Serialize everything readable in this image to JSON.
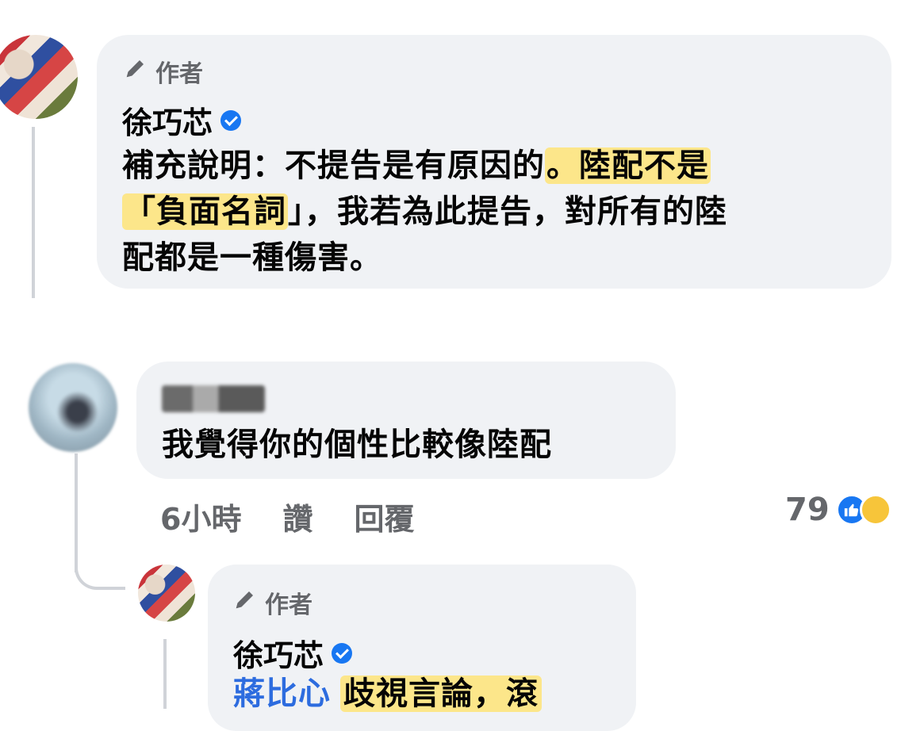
{
  "post_comment": {
    "badge": "作者",
    "author": "徐巧芯",
    "lines": [
      [
        {
          "t": "補充說明：不提告是有原因的",
          "h": false
        },
        {
          "t": "。陸配不是",
          "h": true
        }
      ],
      [
        {
          "t": "「負面名詞",
          "h": true
        },
        {
          "t": "」，我若為此提告，對所有的陸",
          "h": false
        }
      ],
      [
        {
          "t": "配都是一種傷害。",
          "h": false
        }
      ]
    ]
  },
  "reply_comment": {
    "text": "我覺得你的個性比較像陸配",
    "time": "6小時",
    "like_label": "讚",
    "reply_label": "回覆",
    "reaction_count": "79"
  },
  "nested_reply": {
    "badge": "作者",
    "author": "徐巧芯",
    "mention": "蔣比心",
    "text": "歧視言論，滾"
  },
  "colors": {
    "bubble": "#f0f2f5",
    "highlight": "#fce68a",
    "mention": "#2d6cdf",
    "verified": "#1877f2",
    "meta": "#65676b"
  },
  "icons": [
    "pencil-icon",
    "verified-icon",
    "like-icon",
    "haha-icon"
  ]
}
